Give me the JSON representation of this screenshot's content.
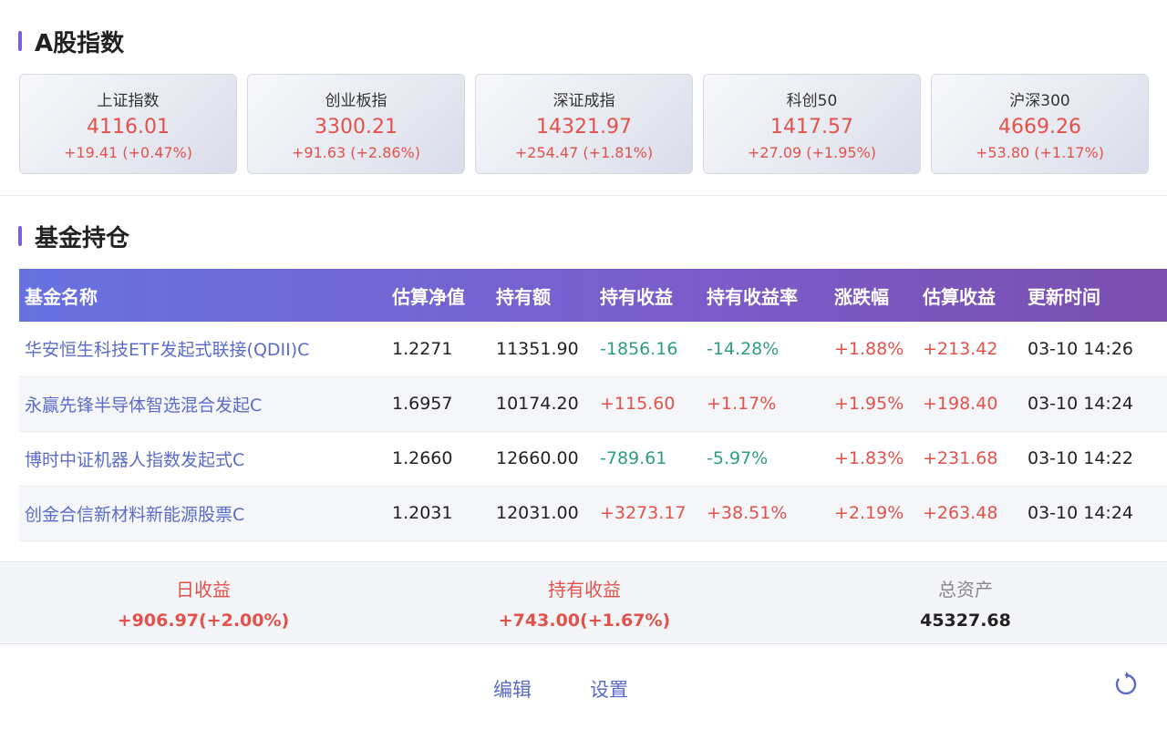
{
  "index_section": {
    "title": "A股指数"
  },
  "indices": [
    {
      "name": "上证指数",
      "value": "4116.01",
      "change": "+19.41 (+0.47%)"
    },
    {
      "name": "创业板指",
      "value": "3300.21",
      "change": "+91.63 (+2.86%)"
    },
    {
      "name": "深证成指",
      "value": "14321.97",
      "change": "+254.47 (+1.81%)"
    },
    {
      "name": "科创50",
      "value": "1417.57",
      "change": "+27.09 (+1.95%)"
    },
    {
      "name": "沪深300",
      "value": "4669.26",
      "change": "+53.80 (+1.17%)"
    }
  ],
  "fund_section": {
    "title": "基金持仓"
  },
  "table": {
    "headers": [
      "基金名称",
      "估算净值",
      "持有额",
      "持有收益",
      "持有收益率",
      "涨跌幅",
      "估算收益",
      "更新时间"
    ],
    "rows": [
      [
        "华安恒生科技ETF发起式联接(QDII)C",
        "1.2271",
        "11351.90",
        "-1856.16",
        "-14.28%",
        "+1.88%",
        "+213.42",
        "03-10 14:26"
      ],
      [
        "永赢先锋半导体智选混合发起C",
        "1.6957",
        "10174.20",
        "+115.60",
        "+1.17%",
        "+1.95%",
        "+198.40",
        "03-10 14:24"
      ],
      [
        "博时中证机器人指数发起式C",
        "1.2660",
        "12660.00",
        "-789.61",
        "-5.97%",
        "+1.83%",
        "+231.68",
        "03-10 14:22"
      ],
      [
        "创金合信新材料新能源股票C",
        "1.2031",
        "12031.00",
        "+3273.17",
        "+38.51%",
        "+2.19%",
        "+263.48",
        "03-10 14:24"
      ]
    ]
  },
  "summary": {
    "daily_label": "日收益",
    "daily_value": "+906.97(+2.00%)",
    "hold_label": "持有收益",
    "hold_value": "+743.00(+1.67%)",
    "total_label": "总资产",
    "total_value": "45327.68"
  },
  "footer": {
    "edit_label": "编辑",
    "settings_label": "设置",
    "refresh_icon": "refresh-icon"
  },
  "colors": {
    "accent": "#7b5fd6",
    "up": "#e2514a",
    "down": "#2f9e80",
    "link": "#5b6bc8"
  }
}
